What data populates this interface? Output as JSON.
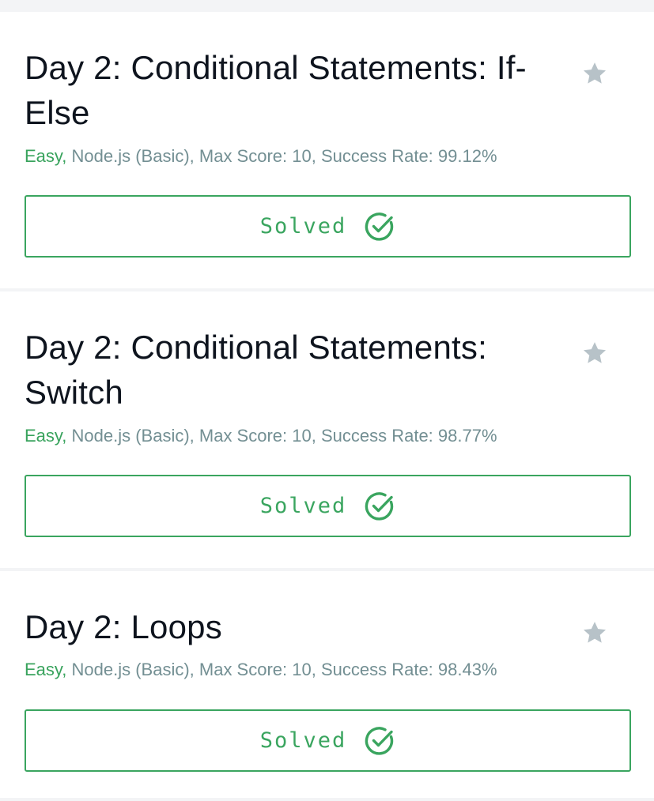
{
  "challenges": [
    {
      "title": "Day 2: Conditional Statements: If-Else",
      "title_line1": "Day 2: Conditional Statements: If-",
      "title_line2": "Else",
      "difficulty": "Easy,",
      "details": " Node.js (Basic), Max Score: 10, Success Rate: 99.12%",
      "status_label": "Solved"
    },
    {
      "title": "Day 2: Conditional Statements: Switch",
      "title_line1": "Day 2: Conditional Statements:",
      "title_line2": "Switch",
      "difficulty": "Easy,",
      "details": " Node.js (Basic), Max Score: 10, Success Rate: 98.77%",
      "status_label": "Solved"
    },
    {
      "title": "Day 2: Loops",
      "title_line1": "Day 2: Loops",
      "title_line2": "",
      "difficulty": "Easy,",
      "details": " Node.js (Basic), Max Score: 10, Success Rate: 98.43%",
      "status_label": "Solved"
    }
  ],
  "icons": {
    "star": "star-icon",
    "check": "check-circle-icon"
  },
  "colors": {
    "success_green": "#3aa55f",
    "title_text": "#0e141e",
    "meta_text": "#738f93",
    "star_gray": "#b7c2c8"
  }
}
